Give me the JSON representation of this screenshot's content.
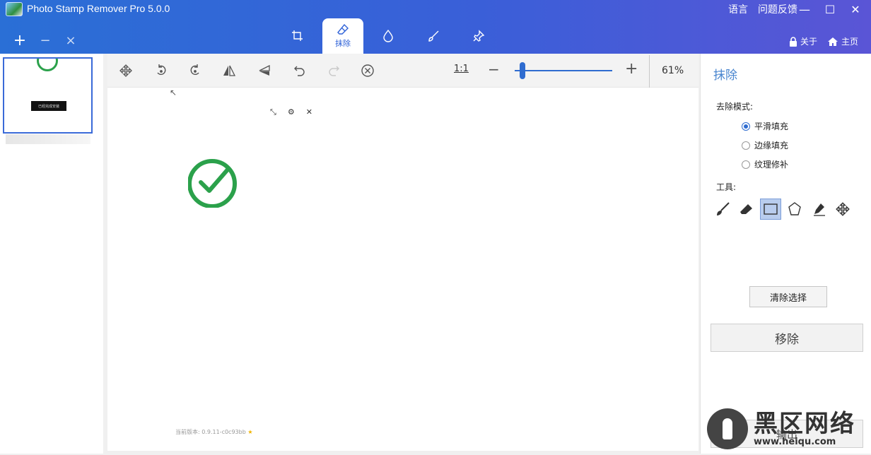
{
  "titlebar": {
    "app_title": "Photo Stamp Remover Pro 5.0.0",
    "language": "语言",
    "feedback": "问题反馈",
    "about": "关于",
    "home": "主页"
  },
  "mode_tabs": [
    {
      "icon": "crop-icon",
      "label": ""
    },
    {
      "icon": "eraser-icon",
      "label": "抹除"
    },
    {
      "icon": "drop-icon",
      "label": ""
    },
    {
      "icon": "brush-icon",
      "label": ""
    },
    {
      "icon": "pin-icon",
      "label": ""
    }
  ],
  "toolbar": {
    "zoom_reset": "1:1",
    "zoom_minus": "−",
    "zoom_plus": "+",
    "zoom_percent": "61%",
    "zoom_level": 0.05
  },
  "canvas": {
    "version_text": "当前版本: 0.9.11-c0c93bb",
    "thumb_bar_text": "已经完成安装"
  },
  "right_panel": {
    "title": "抹除",
    "mode_label": "去除模式:",
    "modes": [
      {
        "label": "平滑填充",
        "checked": true
      },
      {
        "label": "边缘填充",
        "checked": false
      },
      {
        "label": "纹理修补",
        "checked": false
      }
    ],
    "tools_label": "工具:",
    "clear_selection": "清除选择",
    "remove": "移除",
    "export": "输出"
  },
  "watermark": {
    "big": "黑区网络",
    "url": "www.heiqu.com"
  },
  "colors": {
    "accent": "#2f6cd0",
    "title_text": "#4a86cf",
    "check_green": "#2ba14b"
  }
}
